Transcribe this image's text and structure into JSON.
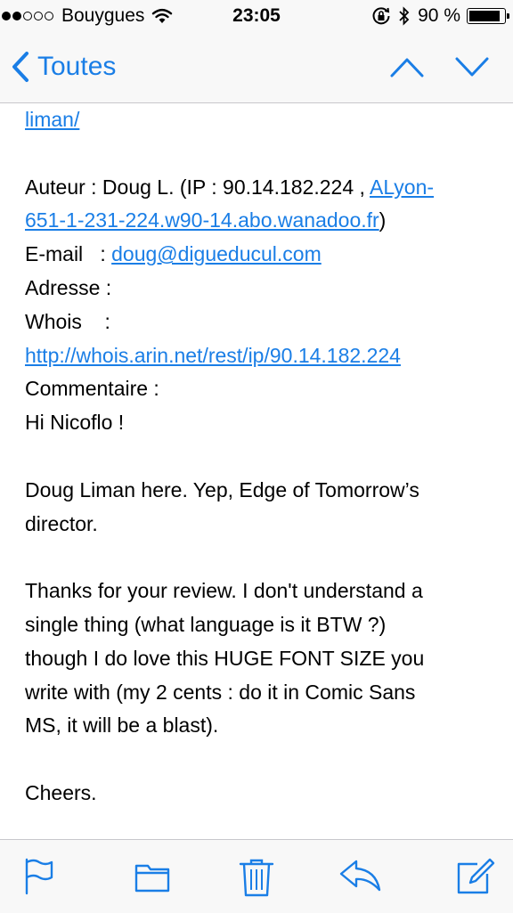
{
  "status_bar": {
    "carrier": "Bouygues",
    "time": "23:05",
    "battery": "90 %",
    "signal_bars_filled": 2,
    "signal_bars_total": 5,
    "battery_level": 0.9
  },
  "nav": {
    "back_label": "Toutes"
  },
  "email": {
    "line1_link": "liman/",
    "author_prefix": "Auteur : Doug L. (IP : 90.14.182.224 , ",
    "author_link_a": "ALyon-",
    "author_link_b": "651-1-231-224.w90-14.abo.wanadoo.fr",
    "author_suffix": ")",
    "email_label": "E-mail   : ",
    "email_link": "doug@digueducul.com",
    "address_label": "Adresse :",
    "whois_label": "Whois    :",
    "whois_link": "http://whois.arin.net/rest/ip/90.14.182.224",
    "comment_label": "Commentaire :",
    "greeting": "Hi Nicoflo !",
    "p1_l1": "Doug Liman here. Yep, Edge of Tomorrow’s",
    "p1_l2": "director.",
    "p2_l1": "Thanks for your review. I don't understand a",
    "p2_l2": "single thing (what language is it BTW ?)",
    "p2_l3": "though I do love this HUGE FONT SIZE you",
    "p2_l4": "write with (my 2 cents : do it in Comic Sans",
    "p2_l5": "MS, it will be a blast).",
    "closing": "Cheers."
  },
  "toolbar": {
    "icons": [
      "flag-icon",
      "folder-icon",
      "trash-icon",
      "reply-icon",
      "compose-icon"
    ]
  },
  "colors": {
    "accent": "#1a7ee6",
    "bar_background": "#f8f8f8",
    "separator": "#c8c7cc"
  }
}
